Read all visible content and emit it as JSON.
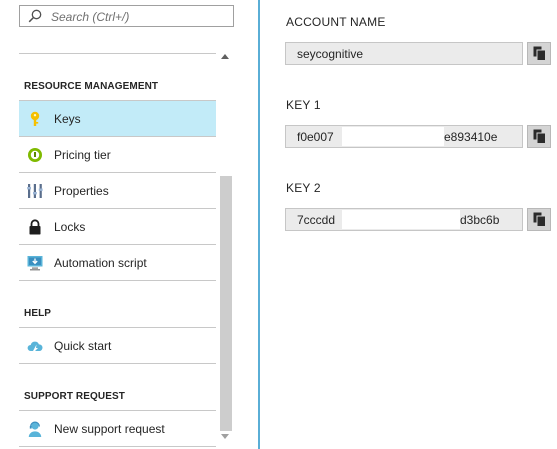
{
  "search": {
    "placeholder": "Search (Ctrl+/)"
  },
  "sections": {
    "resource_management": "RESOURCE MANAGEMENT",
    "help": "HELP",
    "support_request": "SUPPORT REQUEST"
  },
  "menu": {
    "keys": "Keys",
    "pricing_tier": "Pricing tier",
    "properties": "Properties",
    "locks": "Locks",
    "automation_script": "Automation script",
    "quick_start": "Quick start",
    "new_support_request": "New support request"
  },
  "selected_item": "Keys",
  "icons": {
    "search": "search-icon",
    "keys": "key-icon",
    "pricing_tier": "pricing-tier-icon",
    "properties": "properties-icon",
    "locks": "lock-icon",
    "automation_script": "automation-script-icon",
    "quick_start": "cloud-icon",
    "new_support_request": "support-person-icon",
    "copy": "copy-icon"
  },
  "fields": {
    "account_name": {
      "label": "ACCOUNT NAME",
      "value": "seycognitive"
    },
    "key1": {
      "label": "KEY 1",
      "value_start": "f0e007",
      "value_end": "e893410e"
    },
    "key2": {
      "label": "KEY 2",
      "value_start": "7cccdd",
      "value_end": "d3bc6b"
    }
  },
  "colors": {
    "selected_bg": "#c2ebf8",
    "divider": "#5aaed6",
    "key_icon": "#f5c000",
    "field_bg": "#ebebeb"
  }
}
